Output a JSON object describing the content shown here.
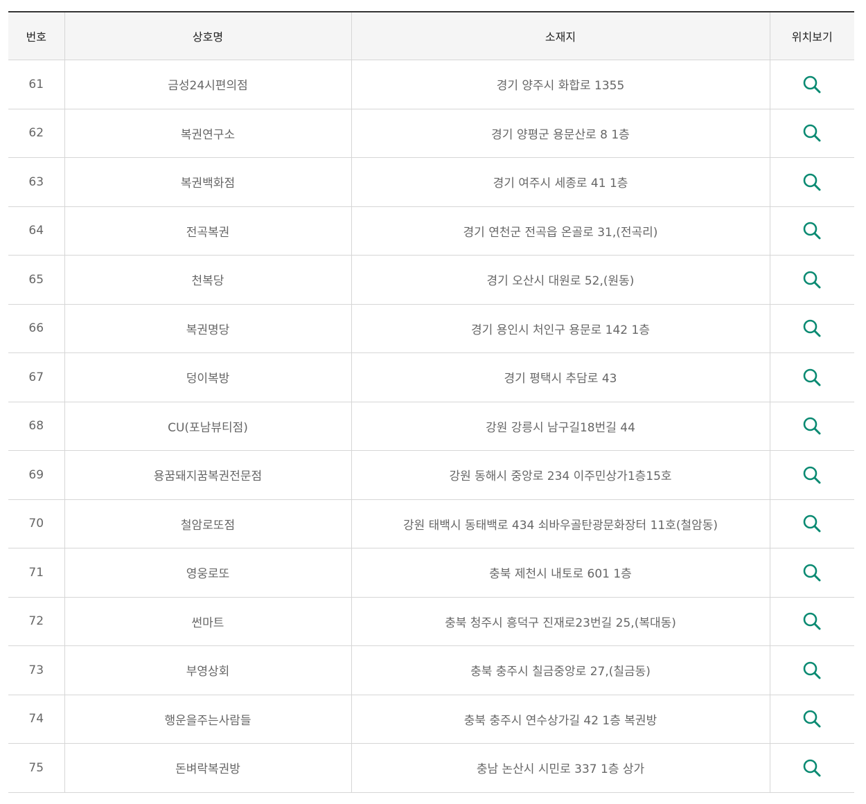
{
  "table": {
    "headers": {
      "number": "번호",
      "name": "상호명",
      "address": "소재지",
      "location": "위치보기"
    },
    "rows": [
      {
        "no": "61",
        "name": "금성24시편의점",
        "address": "경기 양주시 화합로 1355"
      },
      {
        "no": "62",
        "name": "복권연구소",
        "address": "경기 양평군 용문산로 8 1층"
      },
      {
        "no": "63",
        "name": "복권백화점",
        "address": "경기 여주시 세종로 41 1층"
      },
      {
        "no": "64",
        "name": "전곡복권",
        "address": "경기 연천군 전곡읍 온골로 31,(전곡리)"
      },
      {
        "no": "65",
        "name": "천복당",
        "address": "경기 오산시 대원로 52,(원동)"
      },
      {
        "no": "66",
        "name": "복권명당",
        "address": "경기 용인시 처인구 용문로 142 1층"
      },
      {
        "no": "67",
        "name": "덩이복방",
        "address": "경기 평택시 추담로 43"
      },
      {
        "no": "68",
        "name": "CU(포남뷰티점)",
        "address": "강원 강릉시 남구길18번길 44"
      },
      {
        "no": "69",
        "name": "용꿈돼지꿈복권전문점",
        "address": "강원 동해시 중앙로 234 이주민상가1층15호"
      },
      {
        "no": "70",
        "name": "철암로또점",
        "address": "강원 태백시 동태백로 434 쇠바우골탄광문화장터 11호(철암동)"
      },
      {
        "no": "71",
        "name": "영웅로또",
        "address": "충북 제천시 내토로 601 1층"
      },
      {
        "no": "72",
        "name": "썬마트",
        "address": "충북 청주시 흥덕구 진재로23번길 25,(복대동)"
      },
      {
        "no": "73",
        "name": "부영상회",
        "address": "충북 충주시 칠금중앙로 27,(칠금동)"
      },
      {
        "no": "74",
        "name": "행운을주는사람들",
        "address": "충북 충주시 연수상가길 42 1층 복권방"
      },
      {
        "no": "75",
        "name": "돈벼락복권방",
        "address": "충남 논산시 시민로 337 1층 상가"
      }
    ],
    "row_icon": "search-icon",
    "colors": {
      "icon": "#0a8a72",
      "header_bg": "#f5f5f5",
      "top_border": "#333333",
      "cell_border": "#d6d6d6"
    }
  }
}
